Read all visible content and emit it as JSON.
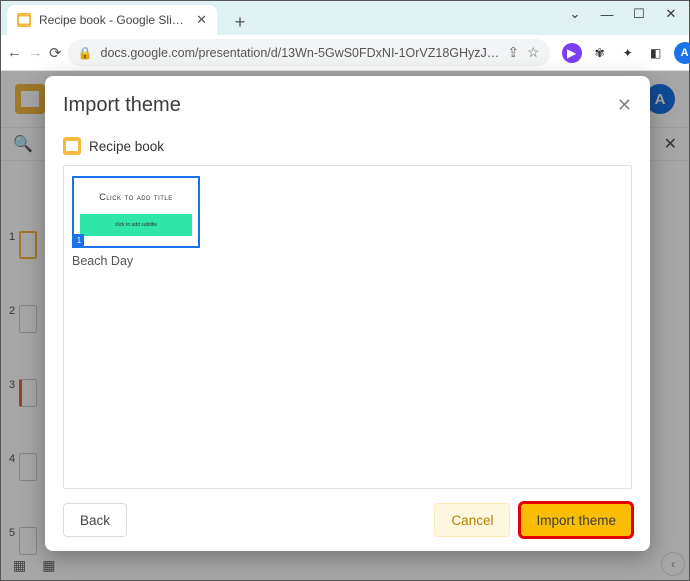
{
  "browser": {
    "tab_title": "Recipe book - Google Slides",
    "url": "docs.google.com/presentation/d/13Wn-5GwS0FDxNI-1OrVZ18GHyzJ…",
    "avatar_letter": "A"
  },
  "app": {
    "avatar_letter": "A",
    "search_icon": "🔍"
  },
  "rail": {
    "nums": [
      "1",
      "2",
      "3",
      "4",
      "5"
    ]
  },
  "modal": {
    "title": "Import theme",
    "source_name": "Recipe book",
    "theme": {
      "thumb_title": "Click to add title",
      "thumb_subtitle": "click to add subtitle",
      "page_num": "1",
      "label": "Beach Day"
    },
    "buttons": {
      "back": "Back",
      "cancel": "Cancel",
      "import": "Import theme"
    }
  }
}
